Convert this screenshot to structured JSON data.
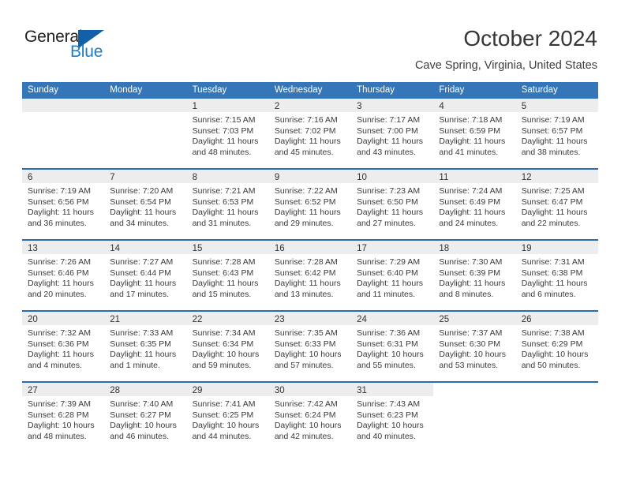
{
  "brand": {
    "name_part1": "General",
    "name_part2": "Blue",
    "logo_icon": "blue-flag-triangle-icon",
    "accent_color": "#1260a8",
    "blue_text_color": "#1b7ec9"
  },
  "header": {
    "title": "October 2024",
    "subtitle": "Cave Spring, Virginia, United States"
  },
  "theme": {
    "header_blue": "#3576b8",
    "separator_blue": "#2b6cb0",
    "daynum_band_gray": "#ededed"
  },
  "calendar": {
    "day_headers": [
      "Sunday",
      "Monday",
      "Tuesday",
      "Wednesday",
      "Thursday",
      "Friday",
      "Saturday"
    ],
    "weeks": [
      [
        {
          "day": "",
          "empty": true,
          "sunrise": "",
          "sunset": "",
          "daylight_line1": "",
          "daylight_line2": ""
        },
        {
          "day": "",
          "empty": true,
          "sunrise": "",
          "sunset": "",
          "daylight_line1": "",
          "daylight_line2": ""
        },
        {
          "day": "1",
          "sunrise": "Sunrise: 7:15 AM",
          "sunset": "Sunset: 7:03 PM",
          "daylight_line1": "Daylight: 11 hours",
          "daylight_line2": "and 48 minutes."
        },
        {
          "day": "2",
          "sunrise": "Sunrise: 7:16 AM",
          "sunset": "Sunset: 7:02 PM",
          "daylight_line1": "Daylight: 11 hours",
          "daylight_line2": "and 45 minutes."
        },
        {
          "day": "3",
          "sunrise": "Sunrise: 7:17 AM",
          "sunset": "Sunset: 7:00 PM",
          "daylight_line1": "Daylight: 11 hours",
          "daylight_line2": "and 43 minutes."
        },
        {
          "day": "4",
          "sunrise": "Sunrise: 7:18 AM",
          "sunset": "Sunset: 6:59 PM",
          "daylight_line1": "Daylight: 11 hours",
          "daylight_line2": "and 41 minutes."
        },
        {
          "day": "5",
          "sunrise": "Sunrise: 7:19 AM",
          "sunset": "Sunset: 6:57 PM",
          "daylight_line1": "Daylight: 11 hours",
          "daylight_line2": "and 38 minutes."
        }
      ],
      [
        {
          "day": "6",
          "sunrise": "Sunrise: 7:19 AM",
          "sunset": "Sunset: 6:56 PM",
          "daylight_line1": "Daylight: 11 hours",
          "daylight_line2": "and 36 minutes."
        },
        {
          "day": "7",
          "sunrise": "Sunrise: 7:20 AM",
          "sunset": "Sunset: 6:54 PM",
          "daylight_line1": "Daylight: 11 hours",
          "daylight_line2": "and 34 minutes."
        },
        {
          "day": "8",
          "sunrise": "Sunrise: 7:21 AM",
          "sunset": "Sunset: 6:53 PM",
          "daylight_line1": "Daylight: 11 hours",
          "daylight_line2": "and 31 minutes."
        },
        {
          "day": "9",
          "sunrise": "Sunrise: 7:22 AM",
          "sunset": "Sunset: 6:52 PM",
          "daylight_line1": "Daylight: 11 hours",
          "daylight_line2": "and 29 minutes."
        },
        {
          "day": "10",
          "sunrise": "Sunrise: 7:23 AM",
          "sunset": "Sunset: 6:50 PM",
          "daylight_line1": "Daylight: 11 hours",
          "daylight_line2": "and 27 minutes."
        },
        {
          "day": "11",
          "sunrise": "Sunrise: 7:24 AM",
          "sunset": "Sunset: 6:49 PM",
          "daylight_line1": "Daylight: 11 hours",
          "daylight_line2": "and 24 minutes."
        },
        {
          "day": "12",
          "sunrise": "Sunrise: 7:25 AM",
          "sunset": "Sunset: 6:47 PM",
          "daylight_line1": "Daylight: 11 hours",
          "daylight_line2": "and 22 minutes."
        }
      ],
      [
        {
          "day": "13",
          "sunrise": "Sunrise: 7:26 AM",
          "sunset": "Sunset: 6:46 PM",
          "daylight_line1": "Daylight: 11 hours",
          "daylight_line2": "and 20 minutes."
        },
        {
          "day": "14",
          "sunrise": "Sunrise: 7:27 AM",
          "sunset": "Sunset: 6:44 PM",
          "daylight_line1": "Daylight: 11 hours",
          "daylight_line2": "and 17 minutes."
        },
        {
          "day": "15",
          "sunrise": "Sunrise: 7:28 AM",
          "sunset": "Sunset: 6:43 PM",
          "daylight_line1": "Daylight: 11 hours",
          "daylight_line2": "and 15 minutes."
        },
        {
          "day": "16",
          "sunrise": "Sunrise: 7:28 AM",
          "sunset": "Sunset: 6:42 PM",
          "daylight_line1": "Daylight: 11 hours",
          "daylight_line2": "and 13 minutes."
        },
        {
          "day": "17",
          "sunrise": "Sunrise: 7:29 AM",
          "sunset": "Sunset: 6:40 PM",
          "daylight_line1": "Daylight: 11 hours",
          "daylight_line2": "and 11 minutes."
        },
        {
          "day": "18",
          "sunrise": "Sunrise: 7:30 AM",
          "sunset": "Sunset: 6:39 PM",
          "daylight_line1": "Daylight: 11 hours",
          "daylight_line2": "and 8 minutes."
        },
        {
          "day": "19",
          "sunrise": "Sunrise: 7:31 AM",
          "sunset": "Sunset: 6:38 PM",
          "daylight_line1": "Daylight: 11 hours",
          "daylight_line2": "and 6 minutes."
        }
      ],
      [
        {
          "day": "20",
          "sunrise": "Sunrise: 7:32 AM",
          "sunset": "Sunset: 6:36 PM",
          "daylight_line1": "Daylight: 11 hours",
          "daylight_line2": "and 4 minutes."
        },
        {
          "day": "21",
          "sunrise": "Sunrise: 7:33 AM",
          "sunset": "Sunset: 6:35 PM",
          "daylight_line1": "Daylight: 11 hours",
          "daylight_line2": "and 1 minute."
        },
        {
          "day": "22",
          "sunrise": "Sunrise: 7:34 AM",
          "sunset": "Sunset: 6:34 PM",
          "daylight_line1": "Daylight: 10 hours",
          "daylight_line2": "and 59 minutes."
        },
        {
          "day": "23",
          "sunrise": "Sunrise: 7:35 AM",
          "sunset": "Sunset: 6:33 PM",
          "daylight_line1": "Daylight: 10 hours",
          "daylight_line2": "and 57 minutes."
        },
        {
          "day": "24",
          "sunrise": "Sunrise: 7:36 AM",
          "sunset": "Sunset: 6:31 PM",
          "daylight_line1": "Daylight: 10 hours",
          "daylight_line2": "and 55 minutes."
        },
        {
          "day": "25",
          "sunrise": "Sunrise: 7:37 AM",
          "sunset": "Sunset: 6:30 PM",
          "daylight_line1": "Daylight: 10 hours",
          "daylight_line2": "and 53 minutes."
        },
        {
          "day": "26",
          "sunrise": "Sunrise: 7:38 AM",
          "sunset": "Sunset: 6:29 PM",
          "daylight_line1": "Daylight: 10 hours",
          "daylight_line2": "and 50 minutes."
        }
      ],
      [
        {
          "day": "27",
          "sunrise": "Sunrise: 7:39 AM",
          "sunset": "Sunset: 6:28 PM",
          "daylight_line1": "Daylight: 10 hours",
          "daylight_line2": "and 48 minutes."
        },
        {
          "day": "28",
          "sunrise": "Sunrise: 7:40 AM",
          "sunset": "Sunset: 6:27 PM",
          "daylight_line1": "Daylight: 10 hours",
          "daylight_line2": "and 46 minutes."
        },
        {
          "day": "29",
          "sunrise": "Sunrise: 7:41 AM",
          "sunset": "Sunset: 6:25 PM",
          "daylight_line1": "Daylight: 10 hours",
          "daylight_line2": "and 44 minutes."
        },
        {
          "day": "30",
          "sunrise": "Sunrise: 7:42 AM",
          "sunset": "Sunset: 6:24 PM",
          "daylight_line1": "Daylight: 10 hours",
          "daylight_line2": "and 42 minutes."
        },
        {
          "day": "31",
          "sunrise": "Sunrise: 7:43 AM",
          "sunset": "Sunset: 6:23 PM",
          "daylight_line1": "Daylight: 10 hours",
          "daylight_line2": "and 40 minutes."
        },
        {
          "day": "",
          "blank": true,
          "sunrise": "",
          "sunset": "",
          "daylight_line1": "",
          "daylight_line2": ""
        },
        {
          "day": "",
          "blank": true,
          "sunrise": "",
          "sunset": "",
          "daylight_line1": "",
          "daylight_line2": ""
        }
      ]
    ]
  }
}
